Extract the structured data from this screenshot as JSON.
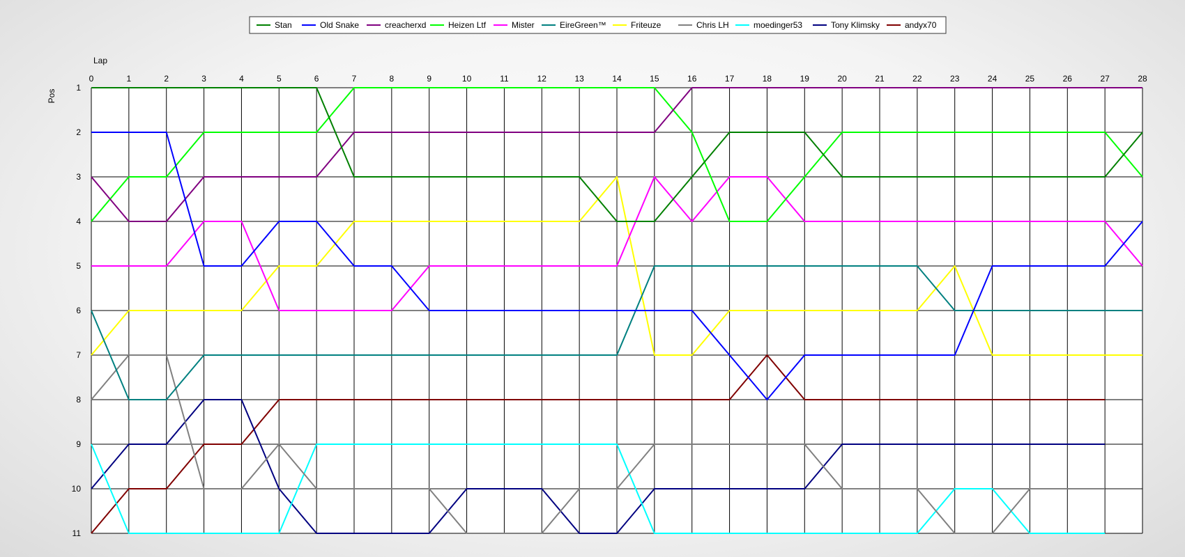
{
  "chart_data": {
    "type": "line",
    "xlabel": "Lap",
    "ylabel": "Pos",
    "xlim": [
      0,
      28
    ],
    "ylim": [
      1,
      11
    ],
    "y_inverted": true,
    "grid": true,
    "legend_placement": "top-center",
    "x": [
      0,
      1,
      2,
      3,
      4,
      5,
      6,
      7,
      8,
      9,
      10,
      11,
      12,
      13,
      14,
      15,
      16,
      17,
      18,
      19,
      20,
      21,
      22,
      23,
      24,
      25,
      26,
      27,
      28
    ],
    "x_ticks": [
      "0",
      "1",
      "2",
      "3",
      "4",
      "5",
      "6",
      "7",
      "8",
      "9",
      "10",
      "11",
      "12",
      "13",
      "14",
      "15",
      "16",
      "17",
      "18",
      "19",
      "20",
      "21",
      "22",
      "23",
      "24",
      "25",
      "26",
      "27",
      "28"
    ],
    "y_ticks": [
      "1",
      "2",
      "3",
      "4",
      "5",
      "6",
      "7",
      "8",
      "9",
      "10",
      "11"
    ],
    "series": [
      {
        "name": "Stan",
        "color": "#008000",
        "values": [
          1,
          1,
          1,
          1,
          1,
          1,
          1,
          3,
          3,
          3,
          3,
          3,
          3,
          3,
          4,
          4,
          3,
          2,
          2,
          2,
          3,
          3,
          3,
          3,
          3,
          3,
          3,
          3,
          2
        ]
      },
      {
        "name": "Old Snake",
        "color": "#0000ff",
        "values": [
          2,
          2,
          2,
          5,
          5,
          4,
          4,
          5,
          5,
          6,
          6,
          6,
          6,
          6,
          6,
          6,
          6,
          7,
          8,
          7,
          7,
          7,
          7,
          7,
          5,
          5,
          5,
          5,
          4
        ]
      },
      {
        "name": "creacherxd",
        "color": "#800080",
        "values": [
          3,
          4,
          4,
          3,
          3,
          3,
          3,
          2,
          2,
          2,
          2,
          2,
          2,
          2,
          2,
          2,
          1,
          1,
          1,
          1,
          1,
          1,
          1,
          1,
          1,
          1,
          1,
          1,
          1
        ]
      },
      {
        "name": "Heizen Ltf",
        "color": "#00ff00",
        "values": [
          4,
          3,
          3,
          2,
          2,
          2,
          2,
          1,
          1,
          1,
          1,
          1,
          1,
          1,
          1,
          1,
          2,
          4,
          4,
          3,
          2,
          2,
          2,
          2,
          2,
          2,
          2,
          2,
          3
        ]
      },
      {
        "name": "Mister",
        "color": "#ff00ff",
        "values": [
          5,
          5,
          5,
          4,
          4,
          6,
          6,
          6,
          6,
          5,
          5,
          5,
          5,
          5,
          5,
          3,
          4,
          3,
          3,
          4,
          4,
          4,
          4,
          4,
          4,
          4,
          4,
          4,
          5
        ]
      },
      {
        "name": "EireGreen™",
        "color": "#008080",
        "values": [
          6,
          8,
          8,
          7,
          7,
          7,
          7,
          7,
          7,
          7,
          7,
          7,
          7,
          7,
          7,
          5,
          5,
          5,
          5,
          5,
          5,
          5,
          5,
          6,
          6,
          6,
          6,
          6,
          6
        ]
      },
      {
        "name": "Friteuze",
        "color": "#ffff00",
        "values": [
          7,
          6,
          6,
          6,
          6,
          5,
          5,
          4,
          4,
          4,
          4,
          4,
          4,
          4,
          3,
          7,
          7,
          6,
          6,
          6,
          6,
          6,
          6,
          5,
          7,
          7,
          7,
          7,
          7
        ]
      },
      {
        "name": "Chris LH",
        "color": "#808080",
        "values": [
          8,
          7,
          7,
          10,
          10,
          9,
          10,
          10,
          10,
          10,
          11,
          11,
          11,
          10,
          10,
          9,
          9,
          9,
          9,
          9,
          10,
          10,
          10,
          11,
          11,
          10,
          10,
          10,
          null
        ]
      },
      {
        "name": "moedinger53",
        "color": "#00ffff",
        "values": [
          9,
          11,
          11,
          11,
          11,
          11,
          9,
          9,
          9,
          9,
          9,
          9,
          9,
          9,
          9,
          11,
          11,
          11,
          11,
          11,
          11,
          11,
          11,
          10,
          10,
          11,
          11,
          11,
          null
        ]
      },
      {
        "name": "Tony Klimsky",
        "color": "#000080",
        "values": [
          10,
          9,
          9,
          8,
          8,
          10,
          11,
          11,
          11,
          11,
          10,
          10,
          10,
          11,
          11,
          10,
          10,
          10,
          10,
          10,
          9,
          9,
          9,
          9,
          9,
          9,
          9,
          9,
          null
        ]
      },
      {
        "name": "andyx70",
        "color": "#800000",
        "values": [
          11,
          10,
          10,
          9,
          9,
          8,
          8,
          8,
          8,
          8,
          8,
          8,
          8,
          8,
          8,
          8,
          8,
          8,
          7,
          8,
          8,
          8,
          8,
          8,
          8,
          8,
          8,
          8,
          null
        ]
      }
    ]
  }
}
